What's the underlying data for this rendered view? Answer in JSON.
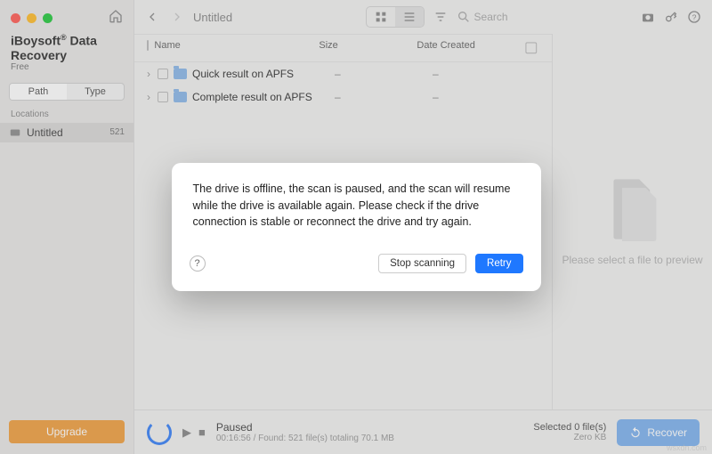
{
  "brand": {
    "name": "iBoysoft",
    "sup": "®",
    "suffix": " Data Recovery",
    "tier": "Free"
  },
  "sidebar": {
    "tabs": {
      "path": "Path",
      "type": "Type"
    },
    "section": "Locations",
    "items": [
      {
        "label": "Untitled",
        "count": "521"
      }
    ],
    "upgrade": "Upgrade"
  },
  "toolbar": {
    "title": "Untitled",
    "search_placeholder": "Search"
  },
  "columns": {
    "name": "Name",
    "size": "Size",
    "date": "Date Created"
  },
  "rows": [
    {
      "name": "Quick result on APFS",
      "size": "–",
      "date": "–"
    },
    {
      "name": "Complete result on APFS",
      "size": "–",
      "date": "–"
    }
  ],
  "preview": {
    "hint": "Please select a file to preview"
  },
  "status": {
    "state": "Paused",
    "detail": "00:16:56 / Found: 521 file(s) totaling 70.1 MB",
    "selected_label": "Selected 0 file(s)",
    "selected_size": "Zero KB",
    "recover": "Recover"
  },
  "modal": {
    "message": "The drive is offline, the scan is paused, and the scan will resume while the drive is available again. Please check if the drive connection is stable or reconnect the drive and try again.",
    "help": "?",
    "stop": "Stop scanning",
    "retry": "Retry"
  },
  "watermark": "wsxdn.com"
}
